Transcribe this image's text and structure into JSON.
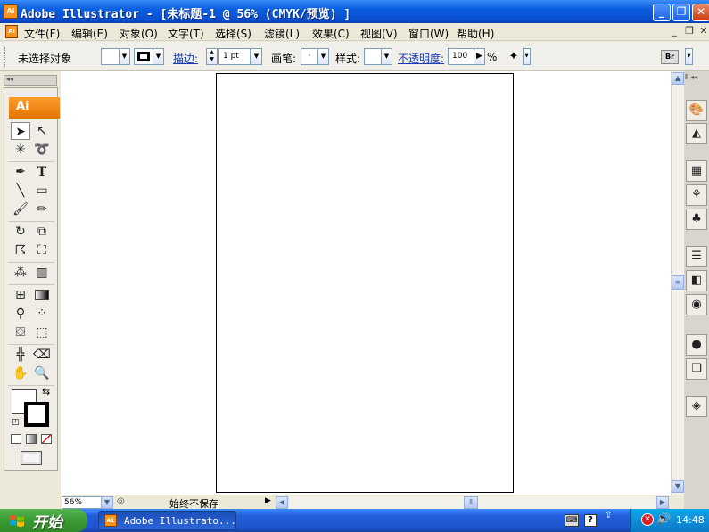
{
  "window": {
    "title": "Adobe Illustrator - [未标题-1 @ 56% (CMYK/预览) ]",
    "app_icon_label": "Ai",
    "controls": [
      "_",
      "❐",
      "✕"
    ]
  },
  "menubar": {
    "items": [
      "文件(F)",
      "编辑(E)",
      "对象(O)",
      "文字(T)",
      "选择(S)",
      "滤镜(L)",
      "效果(C)",
      "视图(V)",
      "窗口(W)",
      "帮助(H)"
    ],
    "doc_controls": [
      "_",
      "❐",
      "✕"
    ]
  },
  "control_bar": {
    "selection_status": "未选择对象",
    "stroke_label": "描边:",
    "stroke_weight": "1 pt",
    "brush_label": "画笔:",
    "brush_value": "·",
    "style_label": "样式:",
    "opacity_label": "不透明度:",
    "opacity_value": "100",
    "opacity_unit": "%",
    "bridge_label": "Br"
  },
  "toolbox": {
    "badge": "Ai",
    "tools": [
      "selection",
      "direct-selection",
      "magic-wand",
      "lasso",
      "pen",
      "type",
      "line-segment",
      "rectangle",
      "paintbrush",
      "pencil",
      "rotate",
      "scale",
      "warp",
      "free-transform",
      "symbol-sprayer",
      "column-graph",
      "mesh",
      "gradient",
      "eyedropper",
      "blend",
      "live-paint-bucket",
      "live-paint-selection",
      "slice",
      "eraser",
      "hand",
      "zoom"
    ]
  },
  "statusbar": {
    "zoom": "56%",
    "status_text": "始终不保存"
  },
  "taskbar": {
    "start_label": "开始",
    "task_item_label": "Adobe Illustrato...",
    "task_icon_label": "Ai",
    "clock": "14:48"
  },
  "colors": {
    "titlebar": "#0a5ee0",
    "ai_orange": "#f7941d",
    "start_green": "#3a9a32",
    "tray_blue": "#0e8fd9"
  }
}
